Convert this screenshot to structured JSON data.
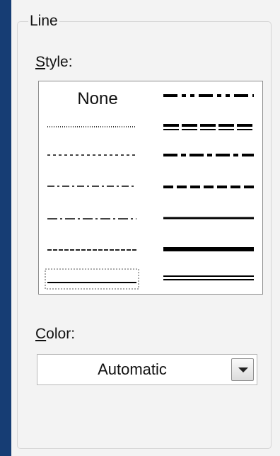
{
  "line_group": {
    "title": "Line"
  },
  "style_field": {
    "label_mnemonic": "S",
    "label_rest": "tyle:",
    "options": {
      "none": "None"
    }
  },
  "color_field": {
    "label_mnemonic": "C",
    "label_rest": "olor:",
    "selected_value": "Automatic"
  },
  "icons": {
    "dropdown": "chevron-down-icon"
  },
  "colors": {
    "outer_background": "#163d74",
    "panel_background": "#f3f3f3",
    "list_background": "#ffffff"
  }
}
